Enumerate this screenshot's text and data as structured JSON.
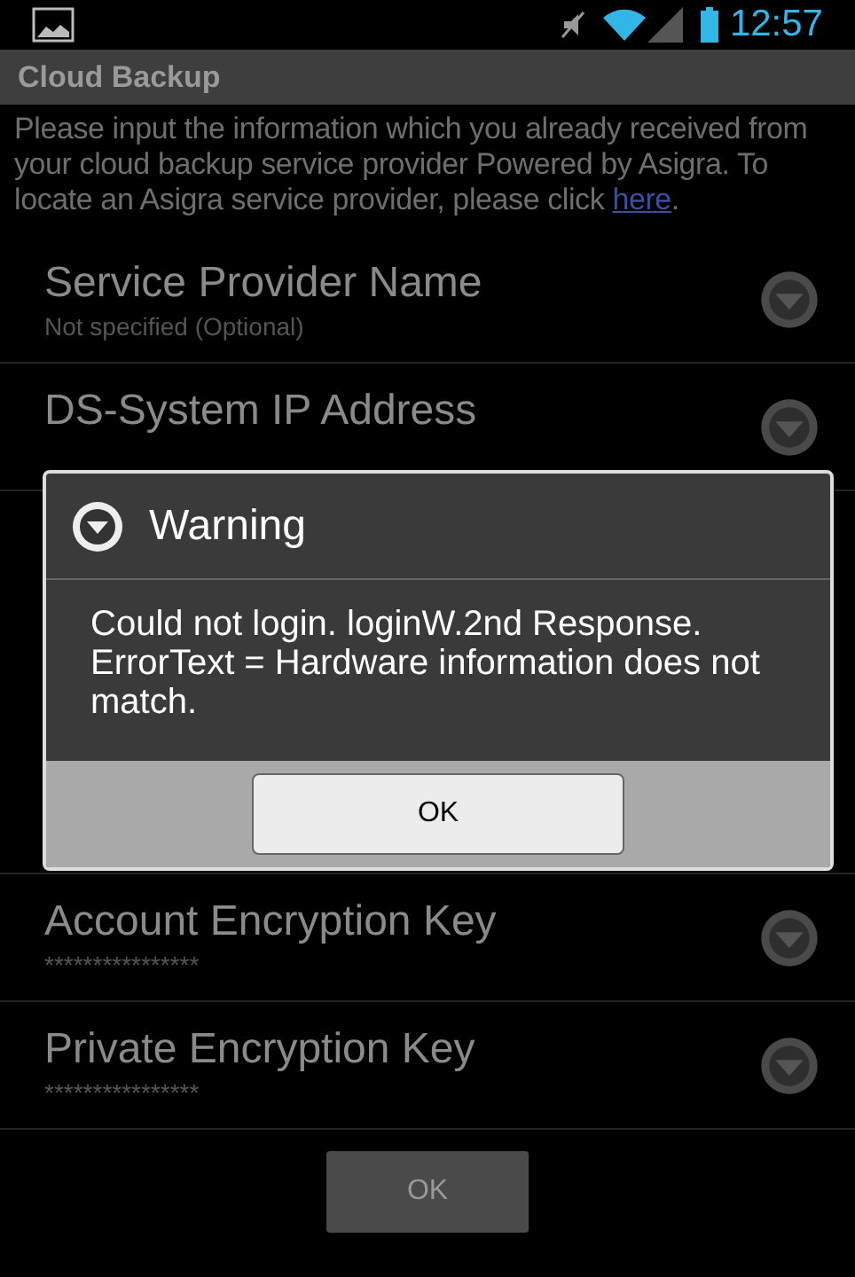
{
  "status_bar": {
    "time": "12:57"
  },
  "title_bar": {
    "title": "Cloud Backup"
  },
  "intro": {
    "text": "Please input the information which you already received from your cloud backup service provider Powered by Asigra. To locate an Asigra service provider, please click",
    "link": "here",
    "after": "."
  },
  "settings_top": [
    {
      "title": "Service Provider Name",
      "value": "Not specified (Optional)"
    },
    {
      "title": "DS-System IP Address"
    }
  ],
  "settings_bottom": [
    {
      "title": "Account Encryption Key",
      "value": "****************"
    },
    {
      "title": "Private Encryption Key",
      "value": "****************"
    }
  ],
  "ok_button": "OK",
  "dialog": {
    "title": "Warning",
    "message": "Could not login. loginW.2nd Response. ErrorText = Hardware information does not match.",
    "button": "OK"
  }
}
